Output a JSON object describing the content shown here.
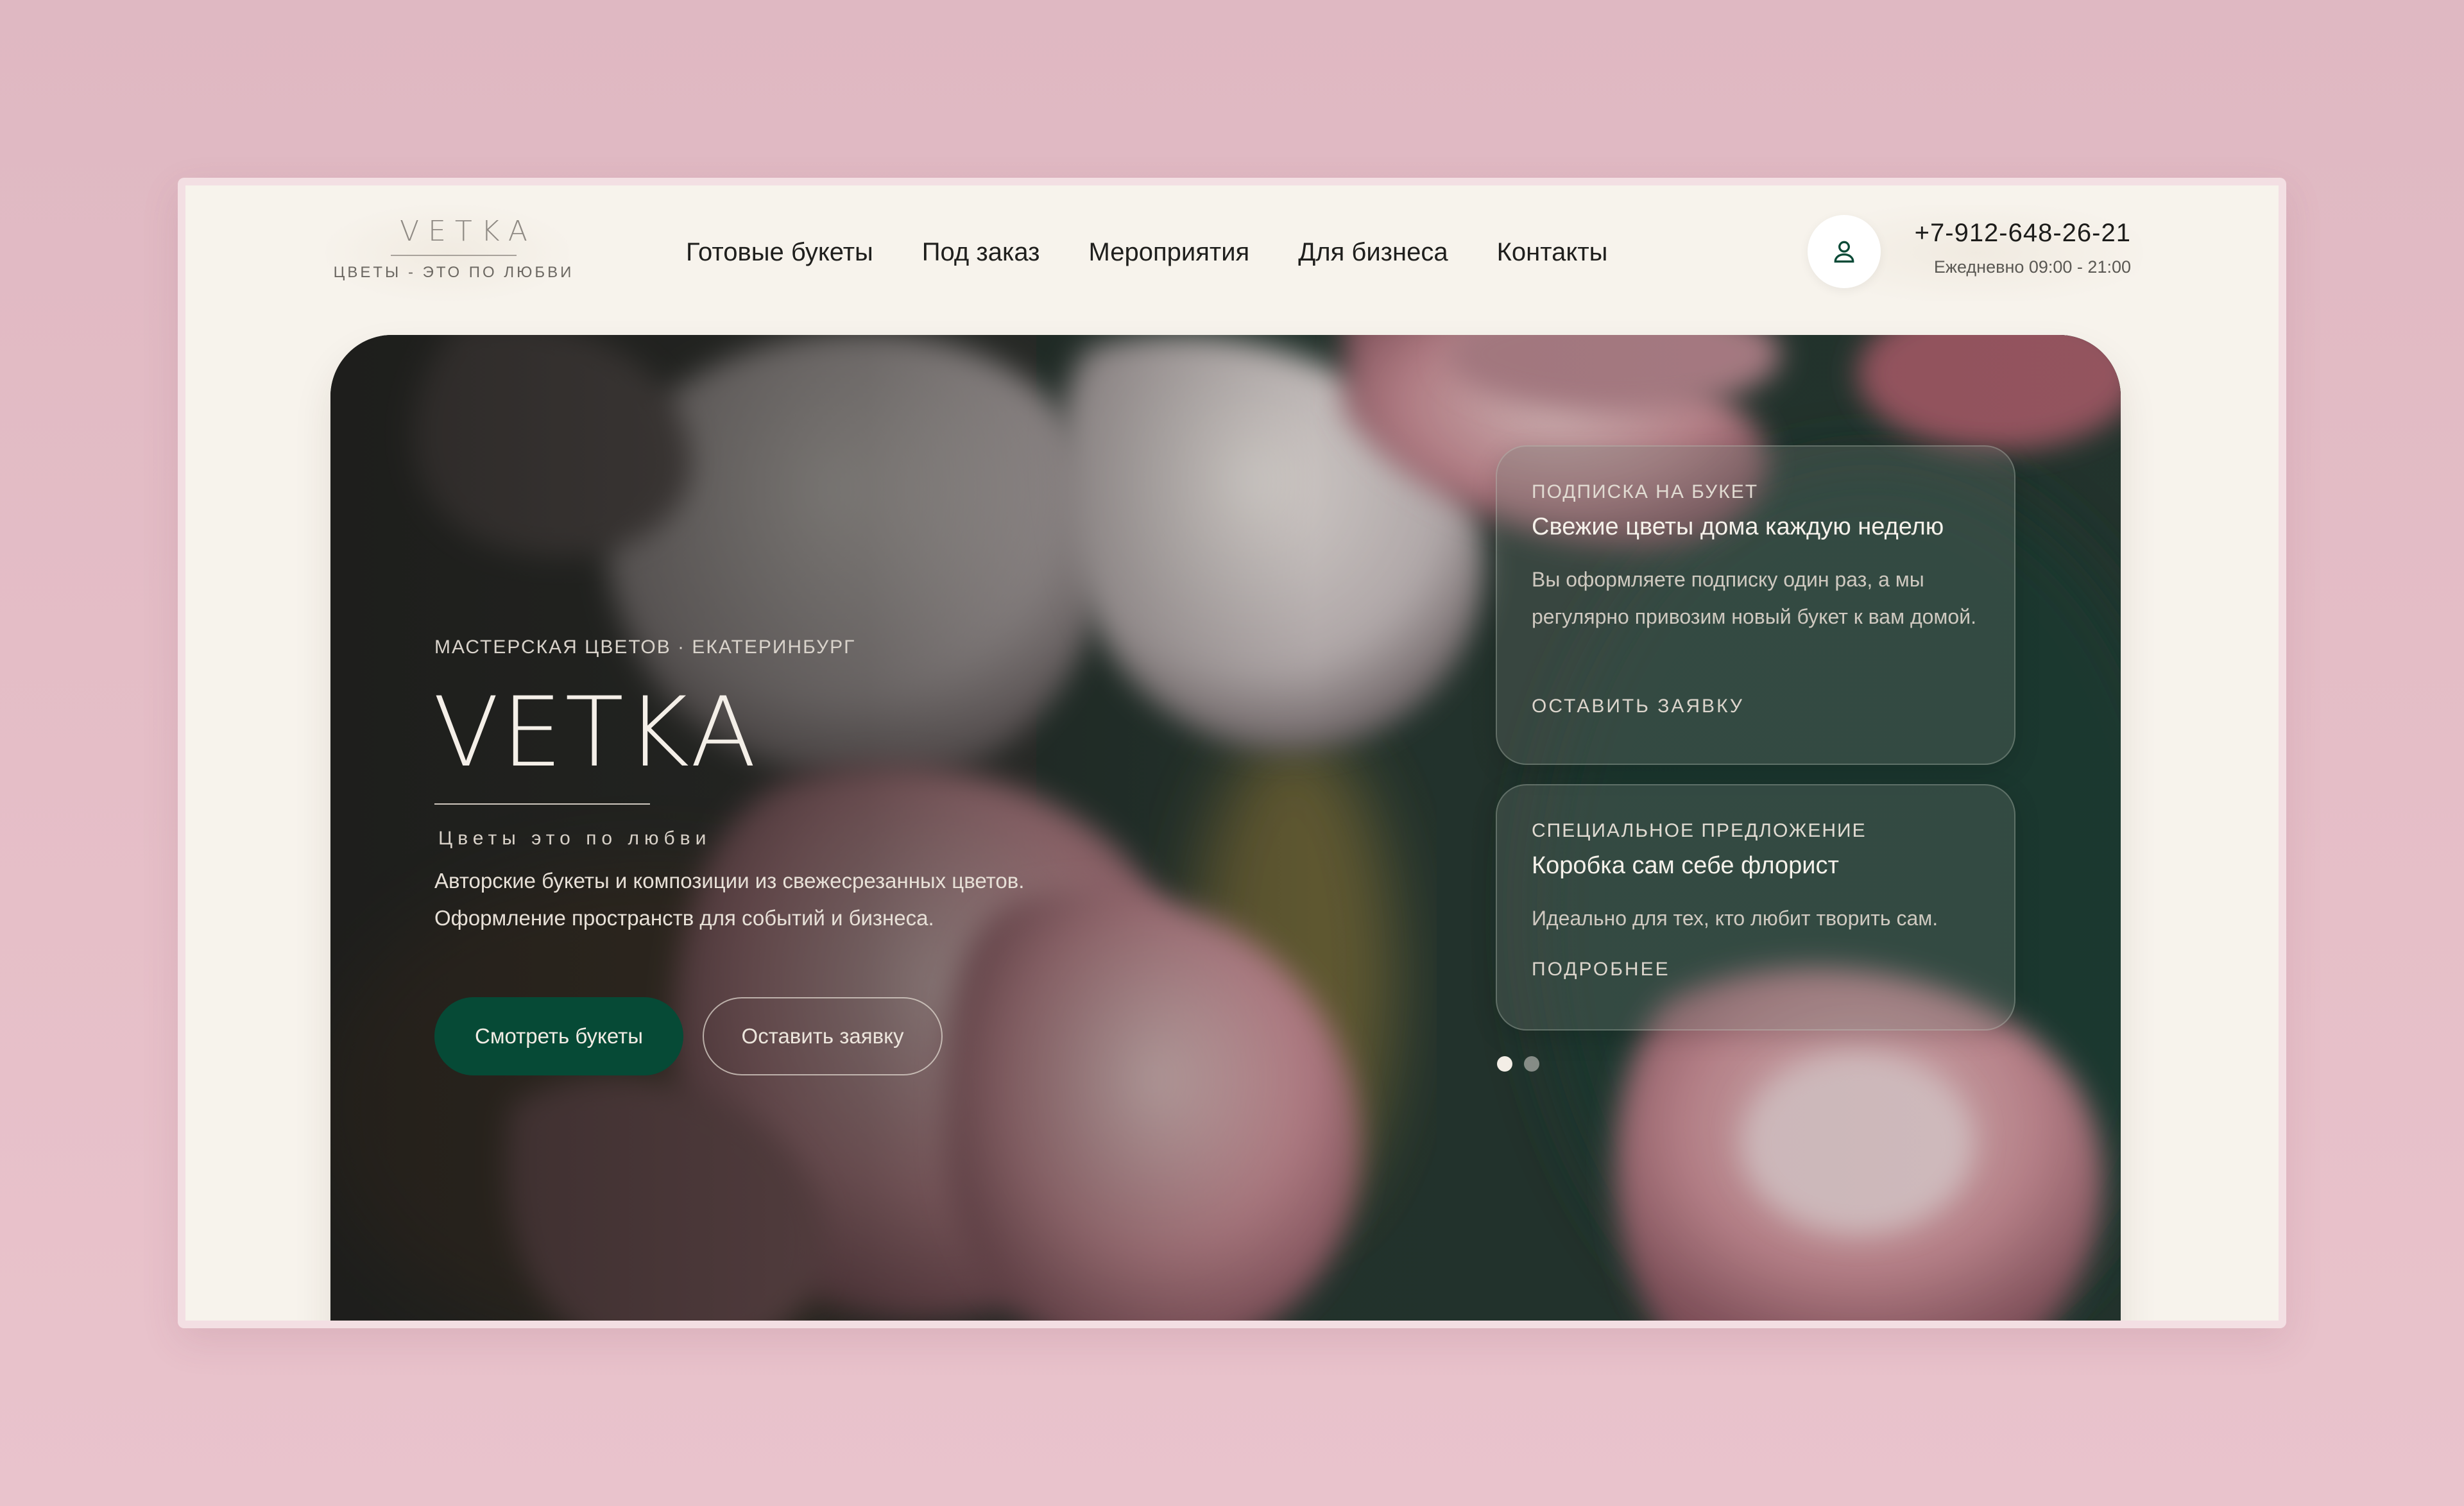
{
  "header": {
    "logo_word": "VETKA",
    "logo_tagline": "ЦВЕТЫ - ЭТО ПО ЛЮБВИ",
    "nav": [
      {
        "label": "Готовые букеты"
      },
      {
        "label": "Под заказ"
      },
      {
        "label": "Мероприятия"
      },
      {
        "label": "Для бизнеса"
      },
      {
        "label": "Контакты"
      }
    ],
    "phone": "+7-912-648-26-21",
    "hours": "Ежедневно 09:00 - 21:00",
    "user_icon": "user-icon"
  },
  "hero": {
    "eyebrow": "МАСТЕРСКАЯ ЦВЕТОВ · ЕКАТЕРИНБУРГ",
    "title": "VETKA",
    "subtitle": "Цветы это по любви",
    "text_line1": "Авторские букеты и композиции из свежесрезанных цветов.",
    "text_line2": "Оформление пространств для событий и бизнеса.",
    "primary_button": "Смотреть букеты",
    "secondary_button": "Оставить заявку"
  },
  "cards": [
    {
      "label": "ПОДПИСКА НА БУКЕТ",
      "title": "Свежие цветы дома каждую неделю",
      "body": "Вы оформляете подписку один раз, а мы регулярно привозим новый букет к вам домой.",
      "link": "ОСТАВИТЬ ЗАЯВКУ"
    },
    {
      "label": "СПЕЦИАЛЬНОЕ ПРЕДЛОЖЕНИЕ",
      "title": "Коробка сам себе флорист",
      "body": "Идеально для тех, кто любит творить сам.",
      "link": "ПОДРОБНЕЕ"
    }
  ],
  "carousel": {
    "active_index": 0,
    "count": 2
  },
  "colors": {
    "page_bg": "#e4bcc6",
    "window_bg": "#f7f3ec",
    "primary_green": "#064a36",
    "text_dark": "#1f1f1d"
  }
}
